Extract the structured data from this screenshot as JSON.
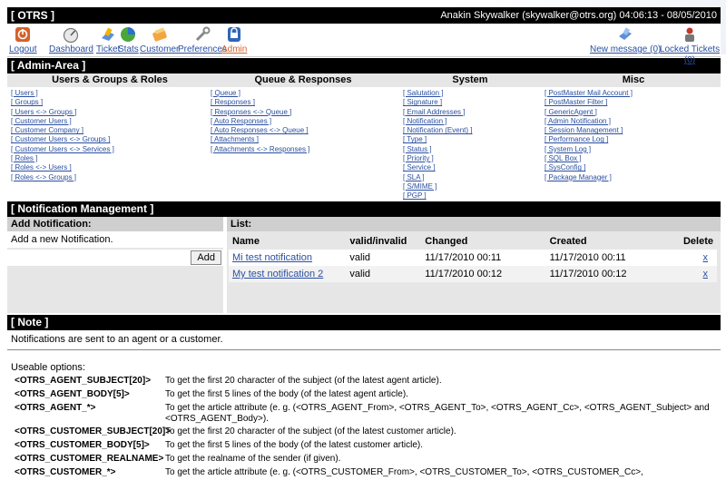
{
  "header": {
    "title": "[ OTRS ]",
    "user_info": "Anakin Skywalker (skywalker@otrs.org) 04:06:13 - 08/05/2010"
  },
  "nav": {
    "items": [
      {
        "label": "Logout",
        "icon": "logout-icon"
      },
      {
        "label": "Dashboard",
        "icon": "dashboard-icon"
      },
      {
        "label": "Ticket",
        "icon": "ticket-icon"
      },
      {
        "label": "Stats",
        "icon": "stats-icon"
      },
      {
        "label": "Customer",
        "icon": "customer-icon"
      },
      {
        "label": "Preferences",
        "icon": "preferences-icon"
      },
      {
        "label": "Admin",
        "icon": "admin-icon"
      }
    ],
    "right": [
      {
        "label": "New message (0)",
        "icon": "new-message-icon"
      },
      {
        "label": "Locked Tickets (0)",
        "icon": "locked-tickets-icon"
      }
    ]
  },
  "admin": {
    "title": "[ Admin-Area ]",
    "columns": [
      {
        "heading": "Users & Groups & Roles",
        "links": [
          "[ Users ]",
          "[ Groups ]",
          "[ Users <-> Groups ]",
          "[ Customer Users ]",
          "[ Customer Company ]",
          "[ Customer Users <-> Groups ]",
          "[ Customer Users <-> Services ]",
          "[ Roles ]",
          "[ Roles <-> Users ]",
          "[ Roles <-> Groups ]"
        ]
      },
      {
        "heading": "Queue & Responses",
        "links": [
          "[ Queue ]",
          "[ Responses ]",
          "[ Responses <-> Queue ]",
          "[ Auto Responses ]",
          "[ Auto Responses <-> Queue ]",
          "[ Attachments ]",
          "[ Attachments <-> Responses ]"
        ]
      },
      {
        "heading": "System",
        "links": [
          "[ Salutation ]",
          "[ Signature ]",
          "[ Email Addresses ]",
          "[ Notification ]",
          "[ Notification (Event) ]",
          "[ Type ]",
          "[ Status ]",
          "[ Priority ]",
          "[ Service ]",
          "[ SLA ]",
          "[ S/MIME ]",
          "[ PGP ]"
        ]
      },
      {
        "heading": "Misc",
        "links": [
          "[ PostMaster Mail Account ]",
          "[ PostMaster Filter ]",
          "[ GenericAgent ]",
          "[ Admin Notification ]",
          "[ Session Management ]",
          "[ Performance Log ]",
          "[ System Log ]",
          "[ SQL Box ]",
          "[ SysConfig ]",
          "[ Package Manager ]"
        ]
      }
    ]
  },
  "notification": {
    "title": "[ Notification Management ]",
    "add_heading": "Add Notification:",
    "add_text": "Add a new Notification.",
    "add_button": "Add",
    "list_heading": "List:",
    "columns": [
      "Name",
      "valid/invalid",
      "Changed",
      "Created",
      "Delete"
    ],
    "rows": [
      {
        "name": "Mi test notification",
        "valid": "valid",
        "changed": "11/17/2010 00:11",
        "created": "11/17/2010 00:11",
        "delete": "x"
      },
      {
        "name": "My test notification 2",
        "valid": "valid",
        "changed": "11/17/2010 00:12",
        "created": "11/17/2010 00:12",
        "delete": "x"
      }
    ]
  },
  "note": {
    "title": "[ Note ]",
    "text": "Notifications are sent to an agent or a customer.",
    "options_label": "Useable options:",
    "options": [
      {
        "key": "<OTRS_AGENT_SUBJECT[20]>",
        "desc": "To get the first 20 character of the subject (of the latest agent article)."
      },
      {
        "key": "<OTRS_AGENT_BODY[5]>",
        "desc": "To get the first 5 lines of the body (of the latest agent article)."
      },
      {
        "key": "<OTRS_AGENT_*>",
        "desc": "To get the article attribute (e. g. (<OTRS_AGENT_From>, <OTRS_AGENT_To>, <OTRS_AGENT_Cc>, <OTRS_AGENT_Subject> and <OTRS_AGENT_Body>)."
      },
      {
        "key": "<OTRS_CUSTOMER_SUBJECT[20]>",
        "desc": "To get the first 20 character of the subject (of the latest customer article)."
      },
      {
        "key": "<OTRS_CUSTOMER_BODY[5]>",
        "desc": "To get the first 5 lines of the body (of the latest customer article)."
      },
      {
        "key": "<OTRS_CUSTOMER_REALNAME>",
        "desc": "To get the realname of the sender (if given)."
      },
      {
        "key": "<OTRS_CUSTOMER_*>",
        "desc": "To get the article attribute (e. g. (<OTRS_CUSTOMER_From>, <OTRS_CUSTOMER_To>, <OTRS_CUSTOMER_Cc>,"
      }
    ]
  }
}
